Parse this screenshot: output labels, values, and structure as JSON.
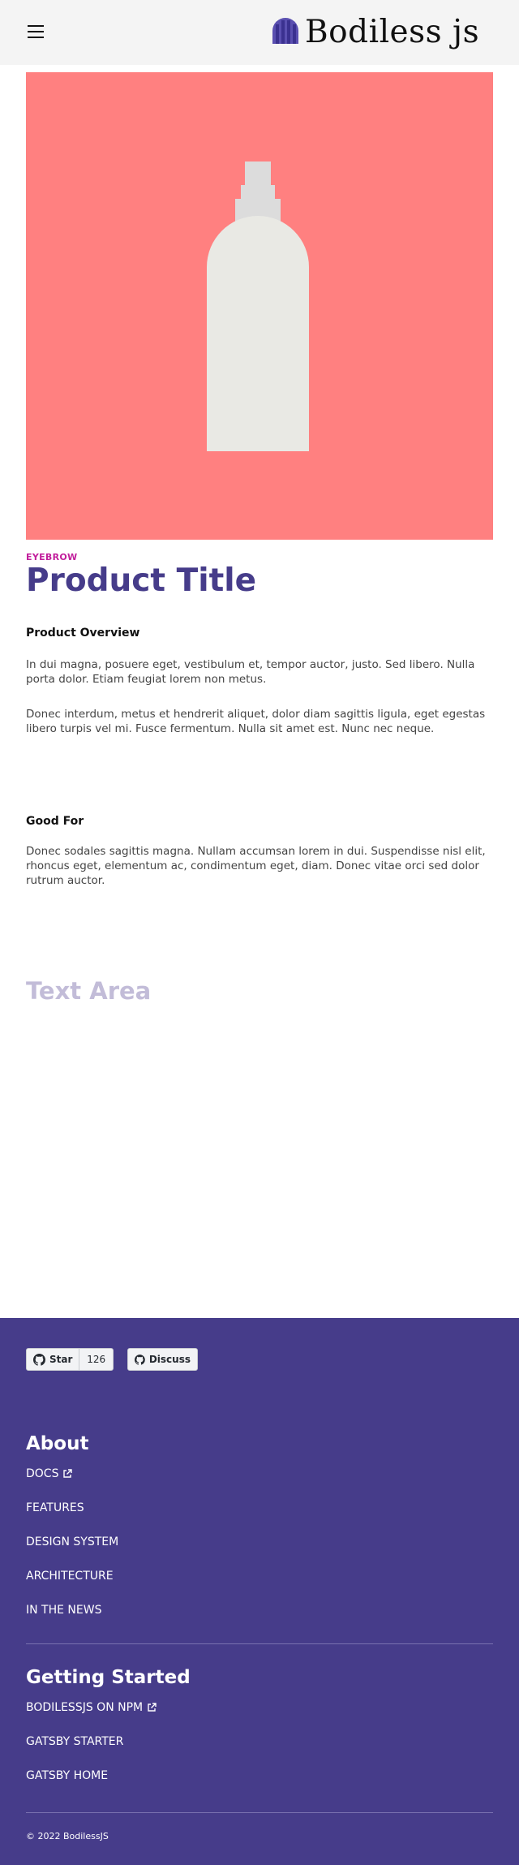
{
  "header": {
    "menu_icon": "hamburger-menu-icon",
    "brand_icon": "bodiless-logo-icon",
    "brand_text": "Bodiless js"
  },
  "hero": {
    "image_icon": "spray-bottle-image",
    "background_color": "#ff8080"
  },
  "product": {
    "eyebrow": "EYEBROW",
    "title": "Product Title",
    "overview_heading": "Product Overview",
    "overview_p1": "In dui magna, posuere eget, vestibulum et, tempor auctor, justo. Sed libero. Nulla porta dolor. Etiam feugiat lorem non metus.",
    "overview_p2": "Donec interdum, metus et hendrerit aliquet, dolor diam sagittis ligula, eget egestas libero turpis vel mi. Fusce fermentum. Nulla sit amet est. Nunc nec neque.",
    "good_for_heading": "Good For",
    "good_for_p": "Donec sodales sagittis magna. Nullam accumsan lorem in dui. Suspendisse nisl elit, rhoncus eget, elementum ac, condimentum eget, diam. Donec vitae orci sed dolor rutrum auctor.",
    "text_area_placeholder": "Text Area"
  },
  "footer": {
    "github": {
      "star_label": "Star",
      "star_count": "126",
      "discuss_label": "Discuss",
      "icon": "github-icon"
    },
    "about": {
      "heading": "About",
      "links": [
        "DOCS",
        "FEATURES",
        "DESIGN SYSTEM",
        "ARCHITECTURE",
        "IN THE NEWS"
      ]
    },
    "getting_started": {
      "heading": "Getting Started",
      "links": [
        "BODILESSJS ON NPM",
        "GATSBY STARTER",
        "GATSBY HOME"
      ]
    },
    "external_link_icon": "external-link-icon",
    "copyright": "©  2022 BodilessJS",
    "background_color": "#463c8a"
  }
}
